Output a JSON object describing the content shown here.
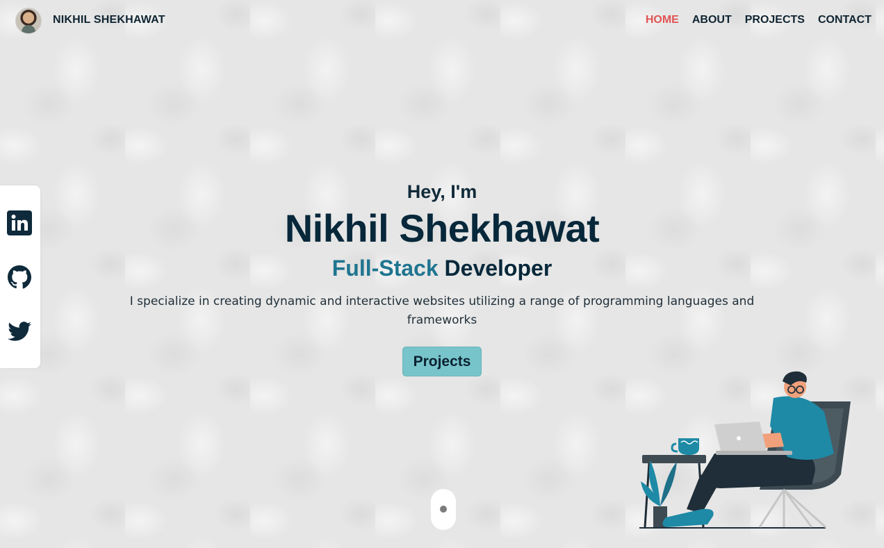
{
  "header": {
    "brand": "NIKHIL SHEKHAWAT",
    "nav": [
      {
        "label": "HOME",
        "active": true
      },
      {
        "label": "ABOUT",
        "active": false
      },
      {
        "label": "PROJECTS",
        "active": false
      },
      {
        "label": "CONTACT",
        "active": false
      }
    ]
  },
  "social": {
    "icons": [
      "linkedin-icon",
      "github-icon",
      "twitter-icon"
    ]
  },
  "hero": {
    "greeting": "Hey, I'm",
    "name": "Nikhil Shekhawat",
    "role_accent": "Full-Stack",
    "role_rest": "Developer",
    "description": "I specialize in creating dynamic and interactive websites utilizing a range of programming languages and frameworks",
    "button_label": "Projects"
  },
  "colors": {
    "active_nav": "#e05454",
    "dark_text": "#07283a",
    "accent": "#1f7590",
    "button": "#78c4cb"
  }
}
